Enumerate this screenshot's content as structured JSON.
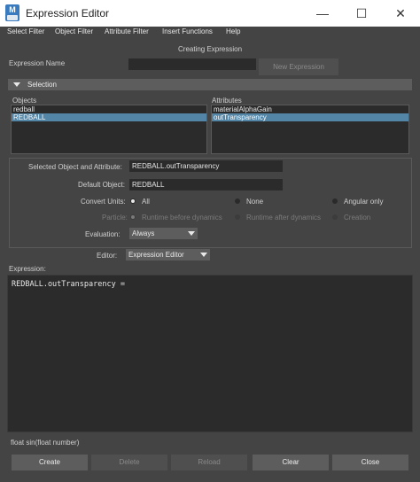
{
  "window": {
    "app_icon_letter": "M",
    "title": "Expression Editor",
    "minimize_glyph": "—",
    "maximize_glyph": "☐",
    "close_glyph": "✕"
  },
  "menu": [
    "Select Filter",
    "Object Filter",
    "Attribute Filter",
    "Insert Functions",
    "Help"
  ],
  "header": {
    "mode_label": "Creating Expression",
    "name_label": "Expression Name",
    "name_value": "",
    "new_button": "New Expression"
  },
  "selection": {
    "section_title": "Selection",
    "objects_label": "Objects",
    "objects": [
      "redball",
      "REDBALL"
    ],
    "selected_object": "REDBALL",
    "attributes_label": "Attributes",
    "attributes": [
      "materialAlphaGain",
      "outTransparency"
    ],
    "selected_attribute": "outTransparency"
  },
  "details": {
    "selected_label": "Selected Object and Attribute:",
    "selected_value": "REDBALL.outTransparency",
    "default_label": "Default Object:",
    "default_value": "REDBALL",
    "convert_label": "Convert Units:",
    "convert_options": [
      "All",
      "None",
      "Angular only"
    ],
    "convert_selected": "All",
    "particle_label": "Particle:",
    "particle_options": [
      "Runtime before dynamics",
      "Runtime after dynamics",
      "Creation"
    ],
    "particle_selected": "Runtime before dynamics",
    "evaluation_label": "Evaluation:",
    "evaluation_value": "Always"
  },
  "editor": {
    "label": "Editor:",
    "value": "Expression Editor"
  },
  "expression": {
    "label": "Expression:",
    "text": "REDBALL.outTransparency ="
  },
  "status": {
    "hint": "float sin(float number)"
  },
  "buttons": {
    "create": "Create",
    "delete": "Delete",
    "reload": "Reload",
    "clear": "Clear",
    "close": "Close"
  },
  "colors": {
    "background": "#444444",
    "field": "#2b2b2b",
    "selection_highlight": "#5285a6",
    "button": "#5d5d5d"
  }
}
